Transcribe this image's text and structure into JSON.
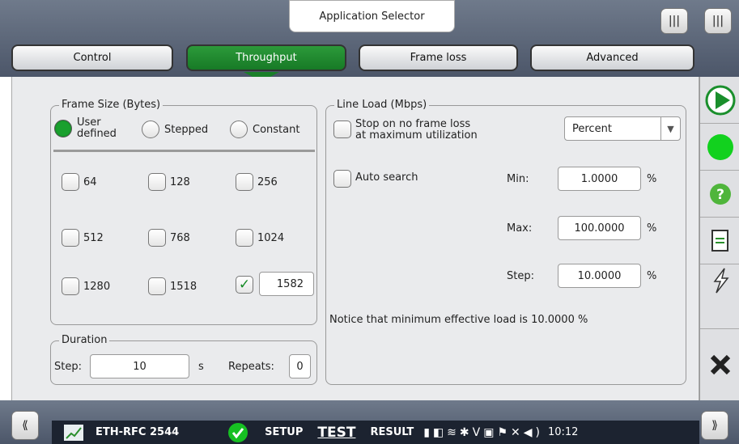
{
  "app_selector": "Application Selector",
  "tabs": [
    "Control",
    "Throughput",
    "Frame loss",
    "Advanced"
  ],
  "frame_size": {
    "title": "Frame Size (Bytes)",
    "radio_user": "User\ndefined",
    "radio_stepped": "Stepped",
    "radio_constant": "Constant",
    "sizes": [
      "64",
      "128",
      "256",
      "512",
      "768",
      "1024",
      "1280",
      "1518"
    ],
    "custom_value": "1582"
  },
  "duration": {
    "title": "Duration",
    "step_label": "Step:",
    "step_value": "10",
    "step_unit": "s",
    "repeats_label": "Repeats:",
    "repeats_value": "0"
  },
  "line_load": {
    "title": "Line Load (Mbps)",
    "stop_label": "Stop on no frame loss\nat maximum utilization",
    "mode": "Percent",
    "auto_search": "Auto search",
    "min_label": "Min:",
    "min_value": "1.0000",
    "max_label": "Max:",
    "max_value": "100.0000",
    "step_label": "Step:",
    "step_value": "10.0000",
    "unit": "%",
    "notice": "Notice that minimum effective load is 10.0000 %"
  },
  "status_bar": {
    "test_name": "ETH-RFC 2544",
    "setup": "SETUP",
    "test": "TEST",
    "result": "RESULT",
    "time": "10:12"
  },
  "colors": {
    "accent_green": "#1a8f2c",
    "top_bar": "#5c6679"
  }
}
